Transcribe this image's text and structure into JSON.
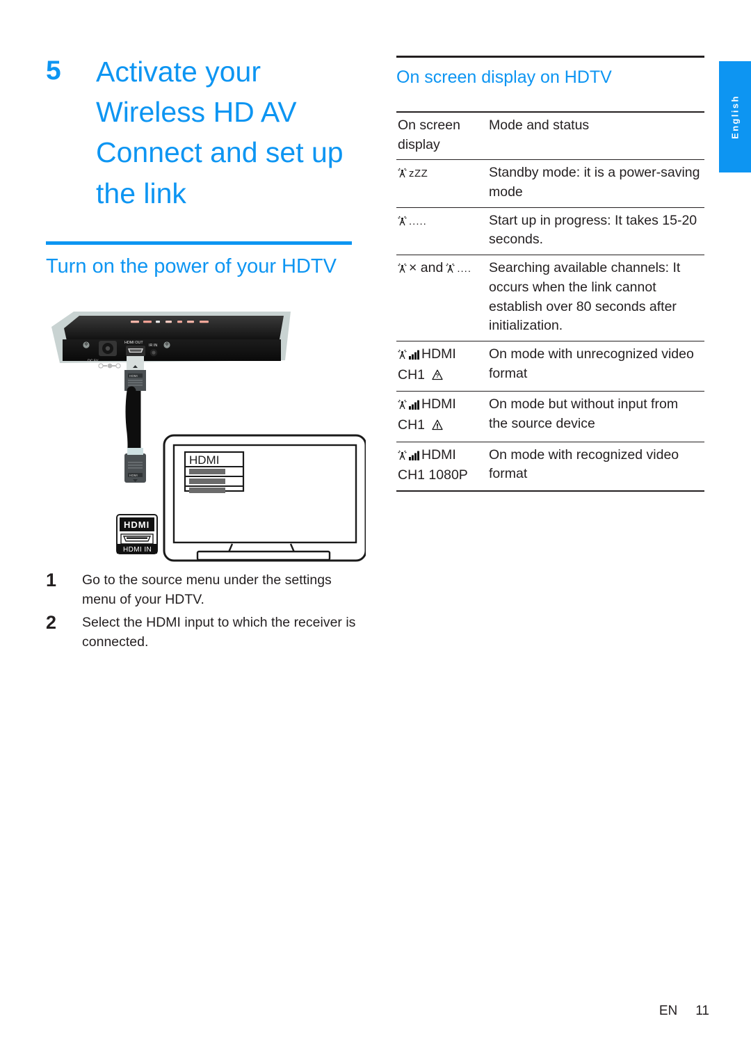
{
  "language_tab": {
    "label": "English"
  },
  "footer": {
    "lang_code": "EN",
    "page_number": "11"
  },
  "chapter": {
    "number": "5",
    "title": "Activate your Wireless HD AV Connect and set up the link"
  },
  "left_section": {
    "heading": "Turn on the power of your HDTV",
    "steps": [
      {
        "number": "1",
        "text": "Go to the source menu under the settings menu of your HDTV."
      },
      {
        "number": "2",
        "text": "Select the HDMI input to which the receiver is connected."
      }
    ]
  },
  "illustration": {
    "device": {
      "port_labels": [
        "DC 5V",
        "HDMI OUT",
        "IR IN"
      ],
      "led_count": 7
    },
    "tv": {
      "menu_title": "HDMI",
      "menu_rows": 3
    },
    "port_badge": {
      "logo": "HDMI",
      "caption": "HDMI IN"
    },
    "cable_connector_label": "HDMI"
  },
  "right_section": {
    "heading": "On screen display on HDTV",
    "table": {
      "headers": [
        "On screen display",
        "Mode and status"
      ],
      "rows": [
        {
          "display_lines": [
            "▒ zZZ"
          ],
          "icons": [
            "antenna-icon"
          ],
          "display_text_1": "zZZ",
          "display_text_2": "",
          "status": "Standby mode: it is a power-saving mode"
        },
        {
          "display_lines": [
            "▒ ....."
          ],
          "icons": [
            "antenna-icon"
          ],
          "display_text_1": ".....",
          "display_text_2": "",
          "status": "Start up in progress: It takes 15-20 seconds."
        },
        {
          "display_lines": [
            "▒ × and ▒ ...."
          ],
          "icons": [
            "antenna-icon",
            "antenna-icon"
          ],
          "display_text_1": "× and",
          "display_text_2": "....",
          "status": "Searching available channels: It occurs when the link cannot establish over 80 seconds after initialization."
        },
        {
          "display_lines": [
            "▒ ◢ HDMI",
            "CH1 ⚠"
          ],
          "icons": [
            "antenna-icon",
            "signal-bars-icon",
            "warning-question-icon"
          ],
          "display_text_1": "HDMI",
          "display_text_2": "CH1",
          "status": "On mode with unrecognized video format"
        },
        {
          "display_lines": [
            "▒ ◢ HDMI",
            "CH1 ⚠"
          ],
          "icons": [
            "antenna-icon",
            "signal-bars-icon",
            "warning-exclaim-icon"
          ],
          "display_text_1": "HDMI",
          "display_text_2": "CH1",
          "status": "On mode but without input from the source device"
        },
        {
          "display_lines": [
            "▒ ◢ HDMI",
            "CH1 1080P"
          ],
          "icons": [
            "antenna-icon",
            "signal-bars-icon"
          ],
          "display_text_1": "HDMI",
          "display_text_2": "CH1 1080P",
          "status": "On mode with recognized video format"
        }
      ]
    }
  },
  "colors": {
    "accent_blue": "#0d95f2",
    "text_black": "#231f20"
  }
}
